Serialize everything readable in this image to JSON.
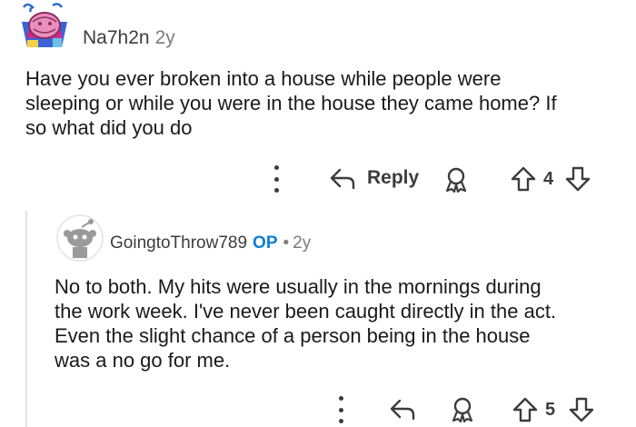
{
  "top_comment": {
    "username": "Na7h2n",
    "age": "2y",
    "body_lines": [
      "Have you ever broken into a house while people were",
      "sleeping or while you were in the house they came home? If",
      "so what did you do"
    ],
    "reply_label": "Reply",
    "vote_count": "4"
  },
  "reply_comment": {
    "username": "GoingtoThrow789",
    "op_badge": "OP",
    "separator": "•",
    "age": "2y",
    "body_lines": [
      "No to both. My hits were usually in the mornings during",
      "the work week. I've never been caught directly in the act.",
      "Even the slight chance of a person being in the house",
      "was a no go for me."
    ],
    "vote_count": "5"
  },
  "colors": {
    "text": "#1a1a1b",
    "meta": "#7c7c7c",
    "op_blue": "#0a7fd8",
    "icon": "#3c3c3c"
  }
}
